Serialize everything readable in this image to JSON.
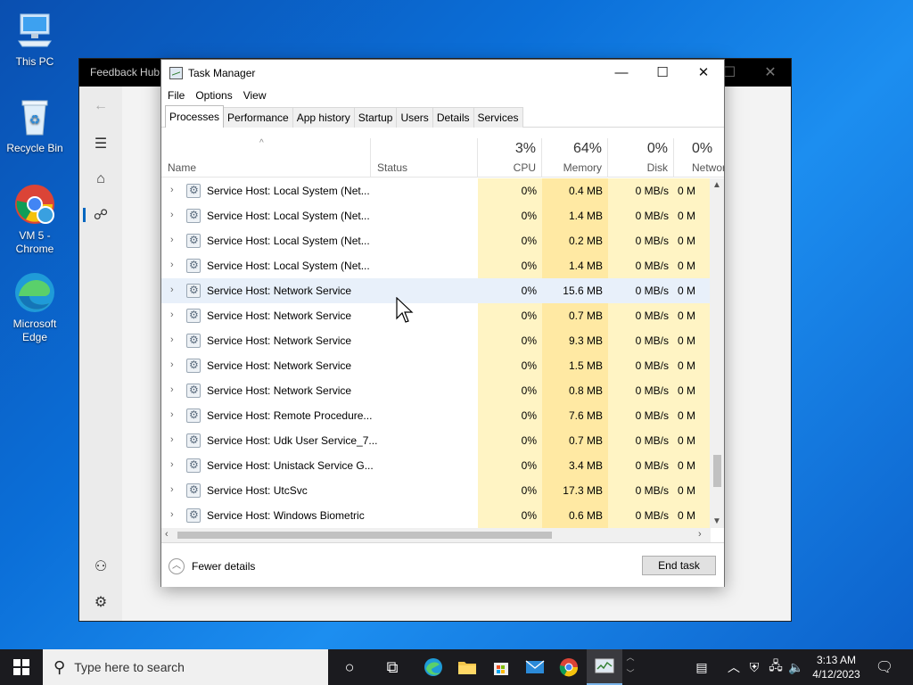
{
  "desktop": {
    "icons": [
      {
        "label": "This PC"
      },
      {
        "label": "Recycle Bin"
      },
      {
        "label": "VM 5 - Chrome"
      },
      {
        "label": "Microsoft Edge"
      }
    ]
  },
  "feedback_hub": {
    "title": "Feedback Hub"
  },
  "task_manager": {
    "title": "Task Manager",
    "menu": [
      "File",
      "Options",
      "View"
    ],
    "tabs": [
      "Processes",
      "Performance",
      "App history",
      "Startup",
      "Users",
      "Details",
      "Services"
    ],
    "columns": {
      "name": "Name",
      "status": "Status",
      "cpu": {
        "pct": "3%",
        "label": "CPU"
      },
      "memory": {
        "pct": "64%",
        "label": "Memory"
      },
      "disk": {
        "pct": "0%",
        "label": "Disk"
      },
      "network": {
        "pct": "0%",
        "label": "Network"
      }
    },
    "rows": [
      {
        "name": "Service Host: Local System (Net...",
        "cpu": "0%",
        "mem": "0.4 MB",
        "disk": "0 MB/s",
        "net": "0 M"
      },
      {
        "name": "Service Host: Local System (Net...",
        "cpu": "0%",
        "mem": "1.4 MB",
        "disk": "0 MB/s",
        "net": "0 M"
      },
      {
        "name": "Service Host: Local System (Net...",
        "cpu": "0%",
        "mem": "0.2 MB",
        "disk": "0 MB/s",
        "net": "0 M"
      },
      {
        "name": "Service Host: Local System (Net...",
        "cpu": "0%",
        "mem": "1.4 MB",
        "disk": "0 MB/s",
        "net": "0 M"
      },
      {
        "name": "Service Host: Network Service",
        "cpu": "0%",
        "mem": "15.6 MB",
        "disk": "0 MB/s",
        "net": "0 M"
      },
      {
        "name": "Service Host: Network Service",
        "cpu": "0%",
        "mem": "0.7 MB",
        "disk": "0 MB/s",
        "net": "0 M"
      },
      {
        "name": "Service Host: Network Service",
        "cpu": "0%",
        "mem": "9.3 MB",
        "disk": "0 MB/s",
        "net": "0 M"
      },
      {
        "name": "Service Host: Network Service",
        "cpu": "0%",
        "mem": "1.5 MB",
        "disk": "0 MB/s",
        "net": "0 M"
      },
      {
        "name": "Service Host: Network Service",
        "cpu": "0%",
        "mem": "0.8 MB",
        "disk": "0 MB/s",
        "net": "0 M"
      },
      {
        "name": "Service Host: Remote Procedure...",
        "cpu": "0%",
        "mem": "7.6 MB",
        "disk": "0 MB/s",
        "net": "0 M"
      },
      {
        "name": "Service Host: Udk User Service_7...",
        "cpu": "0%",
        "mem": "0.7 MB",
        "disk": "0 MB/s",
        "net": "0 M"
      },
      {
        "name": "Service Host: Unistack Service G...",
        "cpu": "0%",
        "mem": "3.4 MB",
        "disk": "0 MB/s",
        "net": "0 M"
      },
      {
        "name": "Service Host: UtcSvc",
        "cpu": "0%",
        "mem": "17.3 MB",
        "disk": "0 MB/s",
        "net": "0 M"
      },
      {
        "name": "Service Host: Windows Biometric",
        "cpu": "0%",
        "mem": "0.6 MB",
        "disk": "0 MB/s",
        "net": "0 M"
      }
    ],
    "footer": {
      "fewer_details": "Fewer details",
      "end_task": "End task"
    }
  },
  "taskbar": {
    "search_placeholder": "Type here to search",
    "time": "3:13 AM",
    "date": "4/12/2023"
  }
}
